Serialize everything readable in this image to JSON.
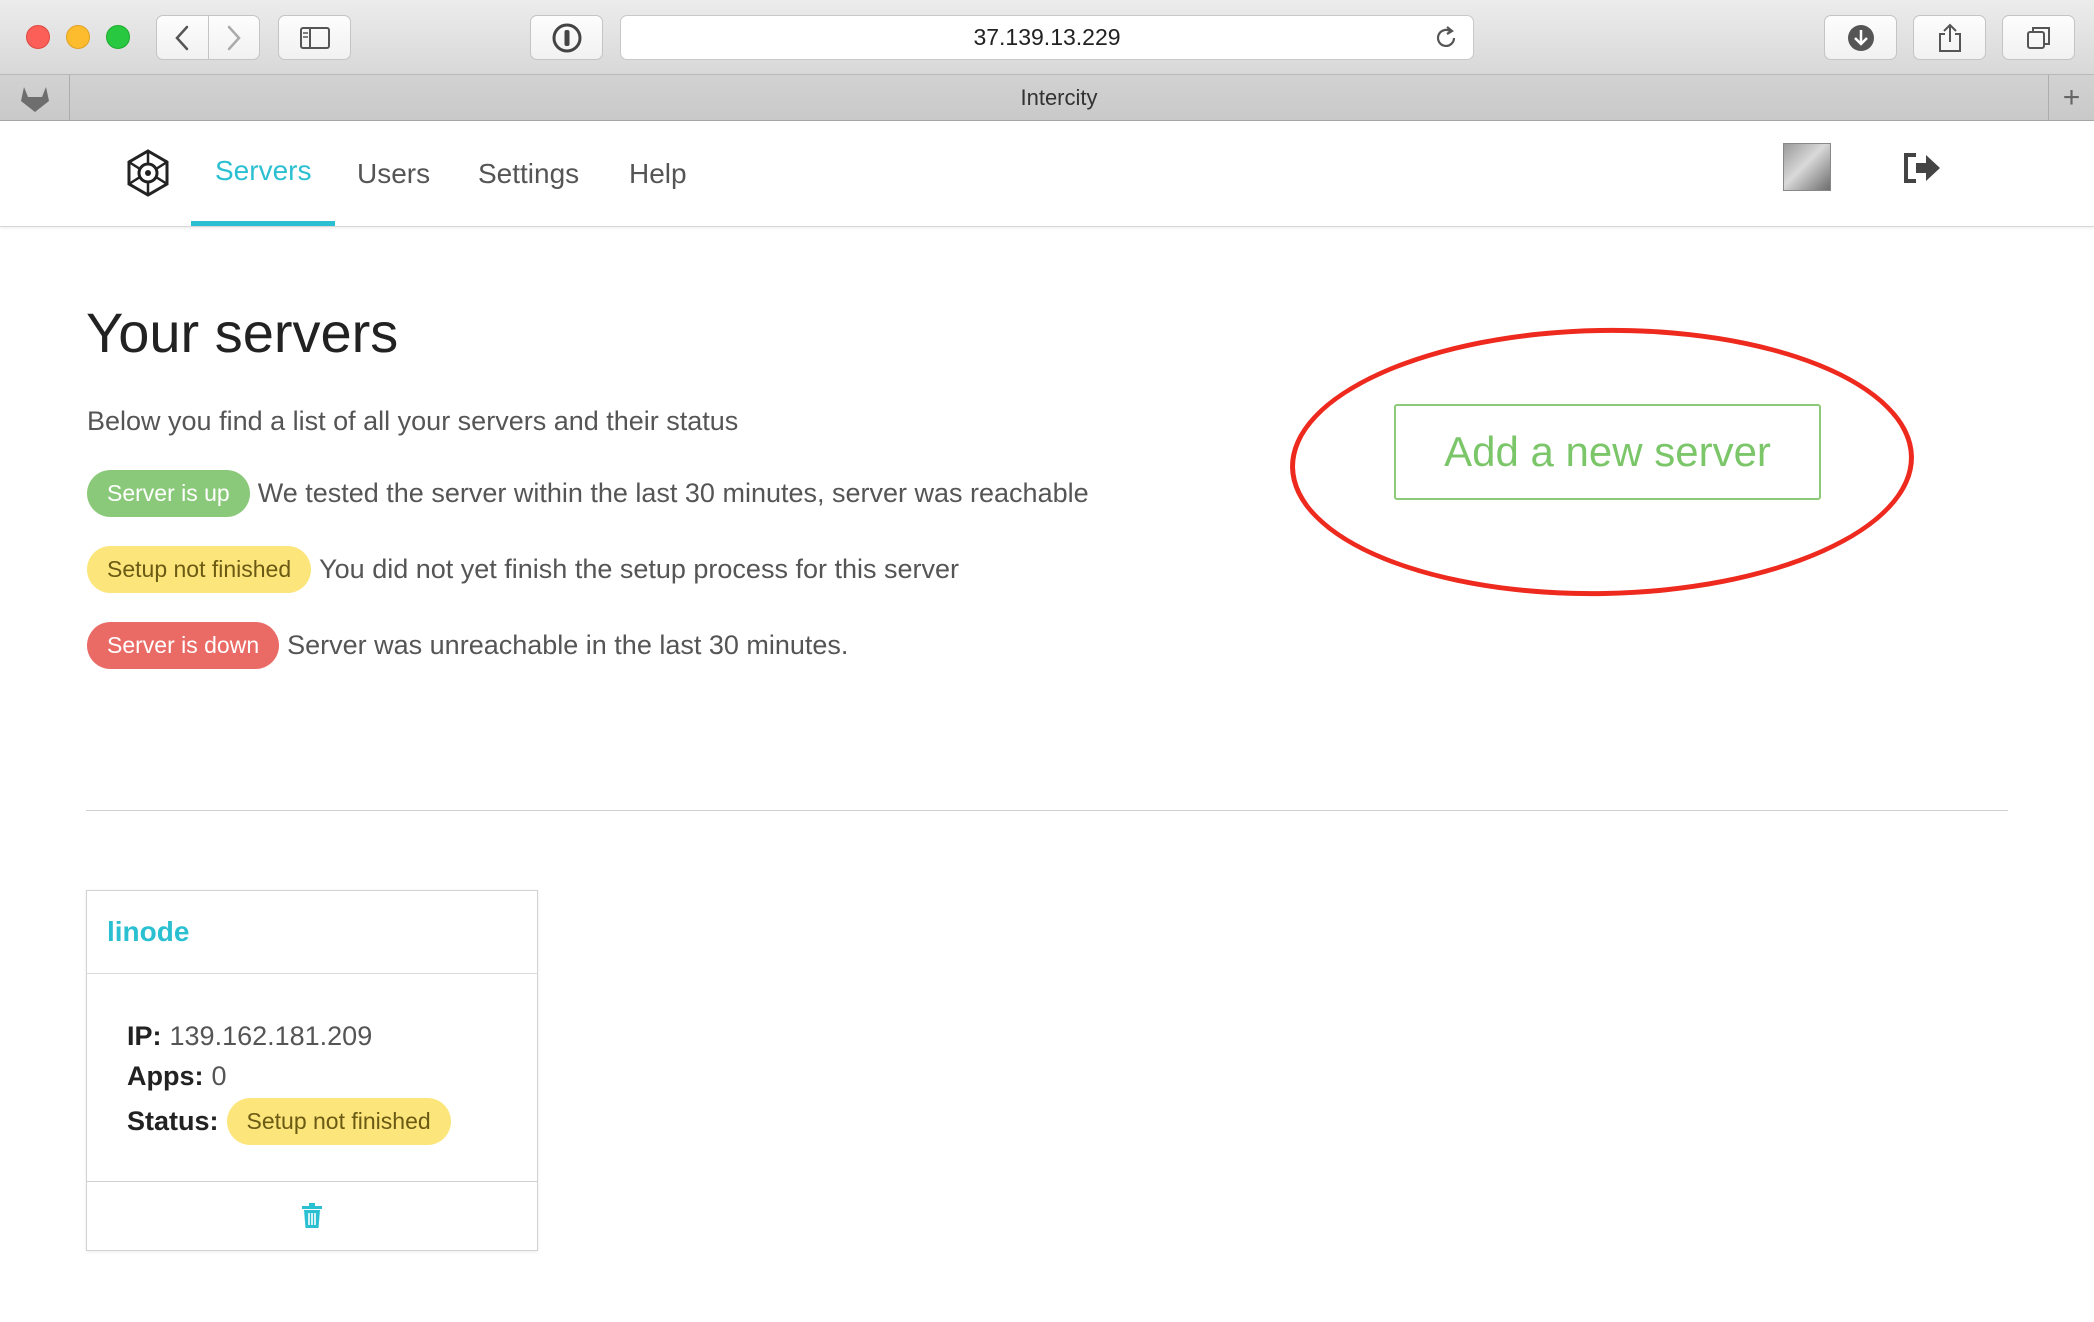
{
  "browser": {
    "url": "37.139.13.229",
    "tab_title": "Intercity",
    "new_tab": "+"
  },
  "nav": {
    "items": [
      {
        "label": "Servers",
        "active": true
      },
      {
        "label": "Users",
        "active": false
      },
      {
        "label": "Settings",
        "active": false
      },
      {
        "label": "Help",
        "active": false
      }
    ],
    "accent_color": "#2bc0d1"
  },
  "main": {
    "title": "Your servers",
    "subtitle": "Below you find a list of all your servers and their status",
    "legend": [
      {
        "badge": "Server is up",
        "description": "We tested the server within the last 30 minutes, server was reachable",
        "color": "#8bc97a"
      },
      {
        "badge": "Setup not finished",
        "description": "You did not yet finish the setup process for this server",
        "color": "#fce57a"
      },
      {
        "badge": "Server is down",
        "description": "Server was unreachable in the last 30 minutes.",
        "color": "#ea6a66"
      }
    ],
    "add_button": "Add a new server",
    "annotation_color": "#ee2a1f"
  },
  "servers": [
    {
      "name": "linode",
      "ip_label": "IP:",
      "ip": "139.162.181.209",
      "apps_label": "Apps:",
      "apps": "0",
      "status_label": "Status:",
      "status": "Setup not finished",
      "delete_icon": "trash-icon"
    }
  ]
}
